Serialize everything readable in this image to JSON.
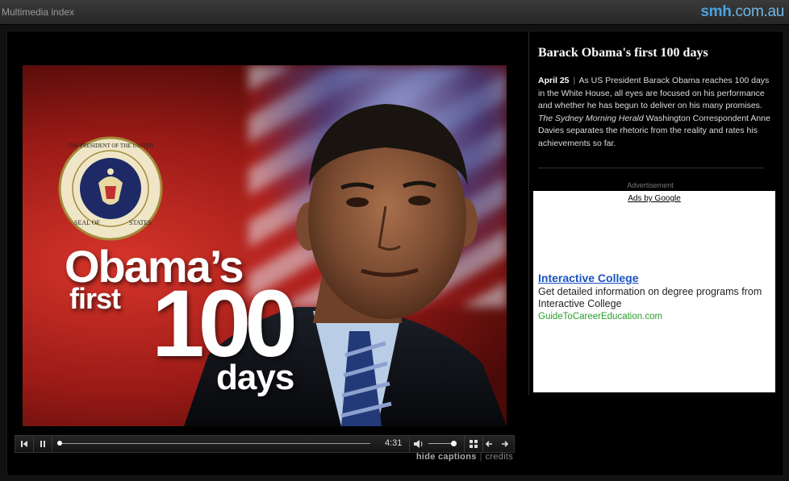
{
  "topbar": {
    "menu_label": "Multimedia index",
    "brand_a": "smh",
    "brand_b": ".com.au"
  },
  "video": {
    "headline_line1": "Obama’s",
    "headline_line2": "first",
    "headline_number": "100",
    "headline_line3": "days",
    "seal_text_top": "THE PRESIDENT OF THE UNITED",
    "seal_text_bottom": "SEAL OF",
    "seal_text_side": "STATES"
  },
  "controls": {
    "time": "4:31",
    "progress": 0.0,
    "volume": 0.9,
    "hide_captions": "hide captions",
    "separator": "|",
    "credits": "credits"
  },
  "story": {
    "title": "Barack Obama's first 100 days",
    "date": "April 25",
    "pipe": "|",
    "body_part1": "As US President Barack Obama reaches 100 days in the White House, all eyes are focused on his performance and whether he has begun to deliver on his many promises.",
    "publication": "The Sydney Morning Herald",
    "body_part2": "Washington Correspondent Anne Davies separates the rhetoric from the reality and rates his achievements so far."
  },
  "ad": {
    "label": "Advertisement",
    "by": "Ads by Google",
    "title": "Interactive College",
    "description": "Get detailed information on degree programs from Interactive College",
    "url": "GuideToCareerEducation.com"
  },
  "colors": {
    "brand_blue": "#4aa3df",
    "ad_link": "#1a53c2",
    "ad_url": "#2a9d2a"
  }
}
